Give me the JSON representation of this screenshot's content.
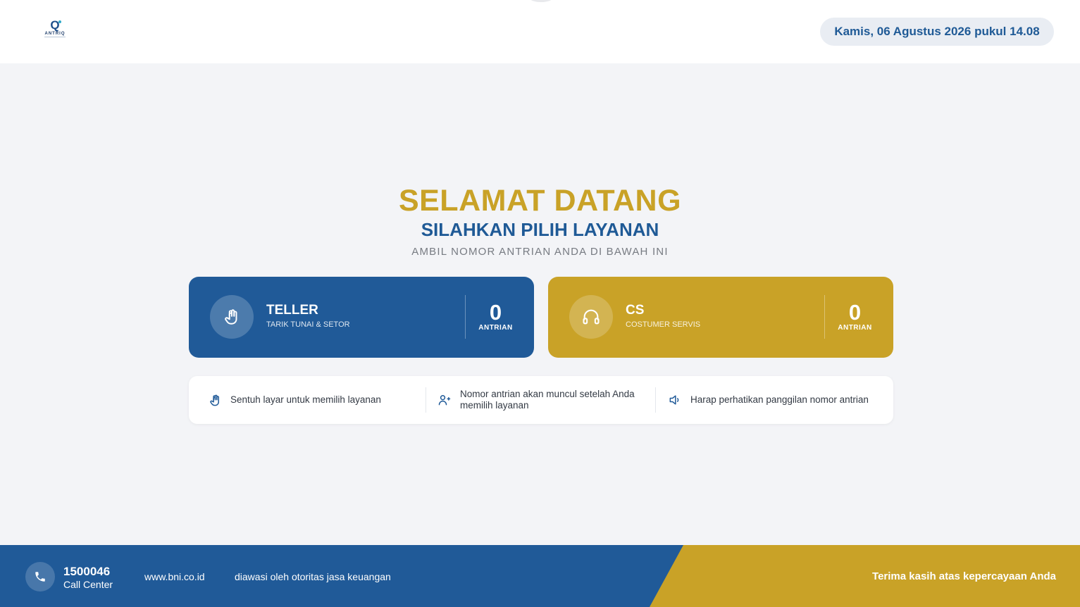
{
  "header": {
    "logo_text": "ANTRIQ",
    "datetime": "Kamis, 06 Agustus 2026 pukul 14.08"
  },
  "hero": {
    "welcome": "SELAMAT DATANG",
    "choose": "SILAHKAN PILIH LAYANAN",
    "take": "AMBIL NOMOR ANTRIAN ANDA DI BAWAH INI"
  },
  "services": [
    {
      "name": "TELLER",
      "subtitle": "TARIK TUNAI & SETOR",
      "count": "0",
      "count_label": "ANTRIAN",
      "icon": "hand-touch-icon",
      "color": "#205a98"
    },
    {
      "name": "CS",
      "subtitle": "COSTUMER SERVIS",
      "count": "0",
      "count_label": "ANTRIAN",
      "icon": "headset-icon",
      "color": "#c9a227"
    }
  ],
  "info": [
    {
      "text": "Sentuh layar untuk memilih layanan",
      "icon": "hand-touch-icon"
    },
    {
      "text": "Nomor antrian akan muncul setelah Anda memilih layanan",
      "icon": "user-add-icon"
    },
    {
      "text": "Harap perhatikan panggilan nomor antrian",
      "icon": "speaker-icon"
    }
  ],
  "footer": {
    "call_number": "1500046",
    "call_label": "Call Center",
    "website": "www.bni.co.id",
    "supervised": "diawasi oleh otoritas jasa keuangan",
    "thanks": "Terima kasih atas kepercayaan Anda"
  },
  "colors": {
    "primary_blue": "#205a98",
    "accent_gold": "#c9a227",
    "background": "#f3f4f7"
  }
}
